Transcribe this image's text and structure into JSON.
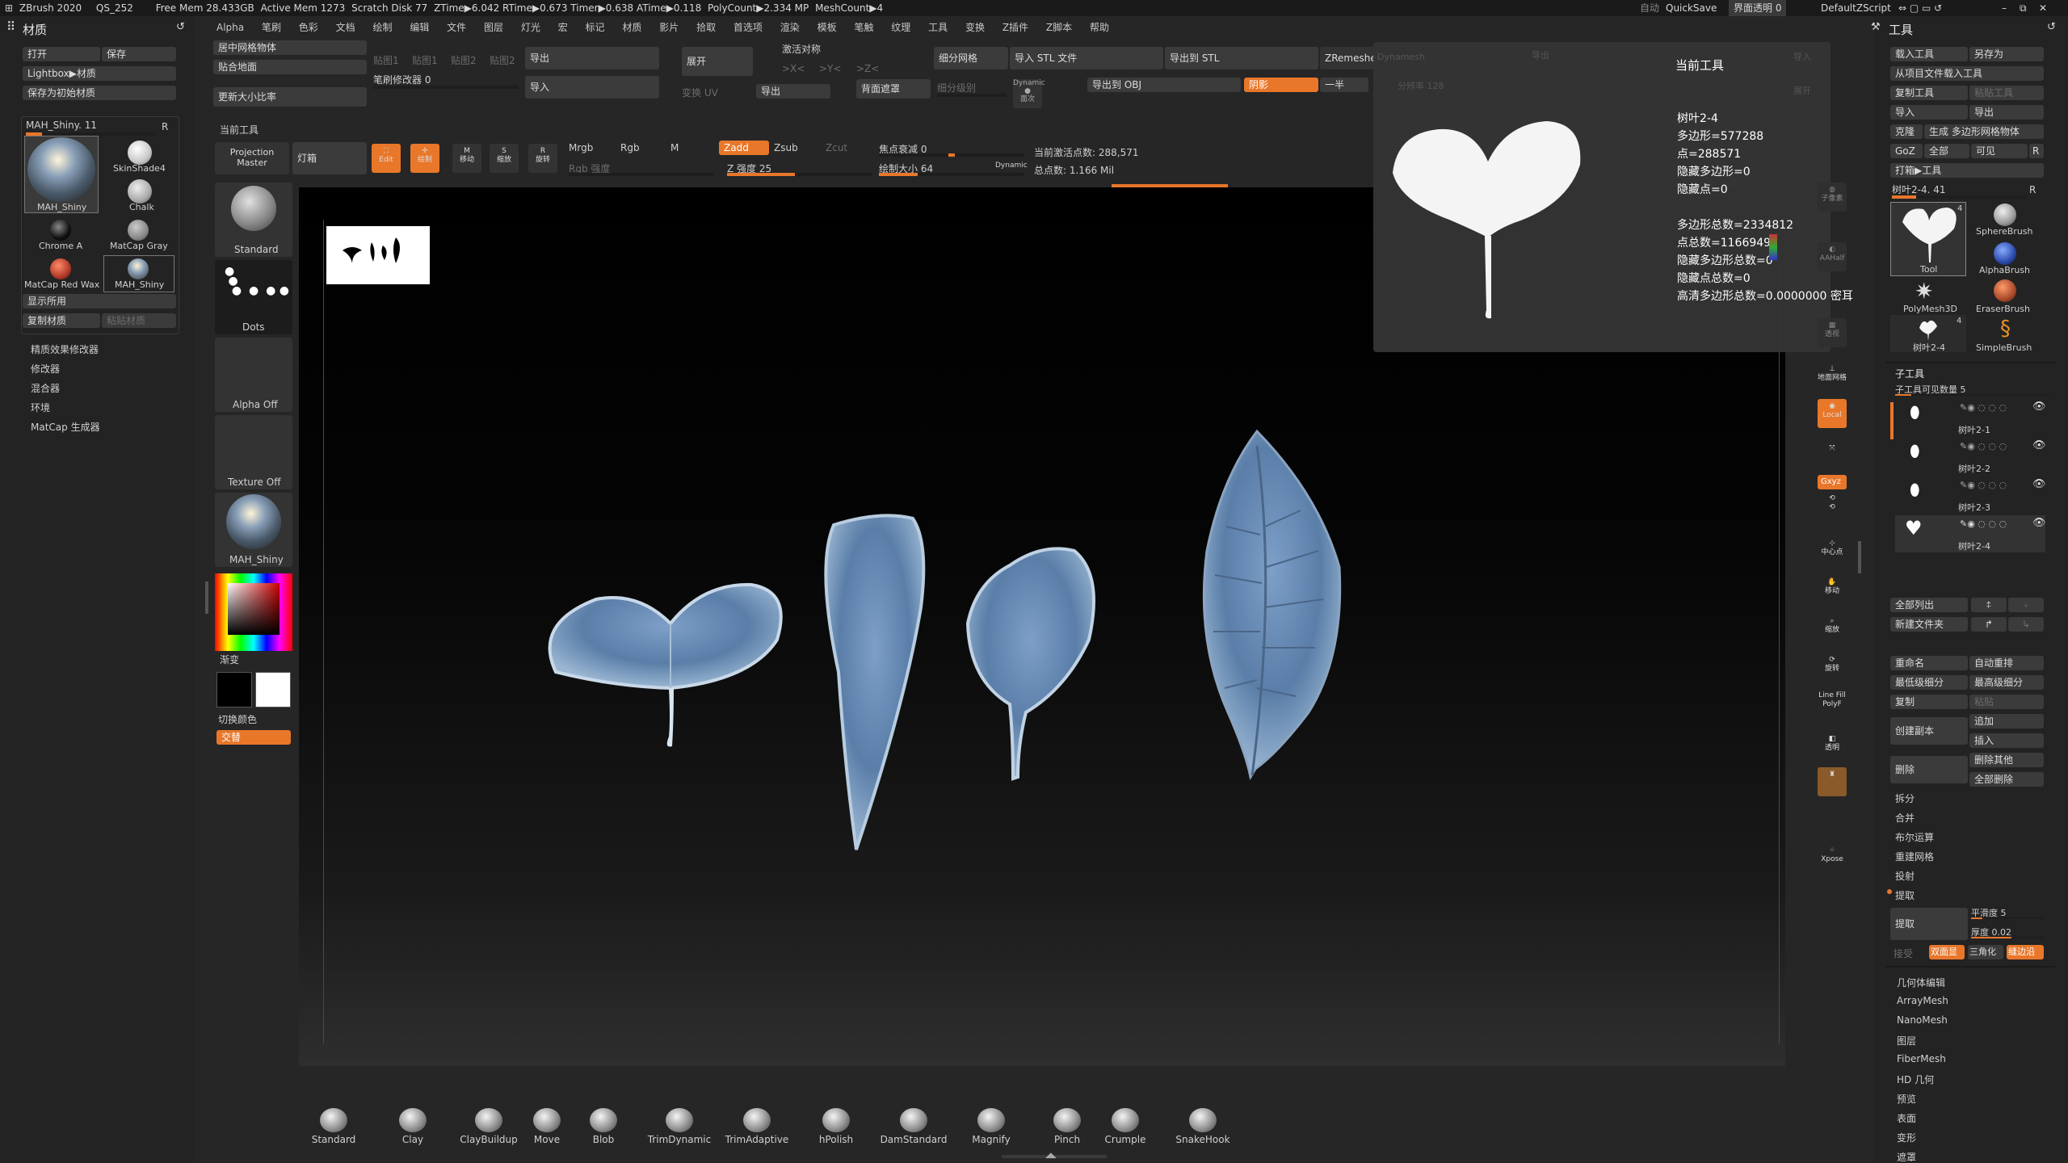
{
  "titlebar": {
    "app": "ZBrush 2020",
    "project": "QS_252",
    "free_mem": "Free Mem 28.433GB",
    "active_mem": "Active Mem 1273",
    "scratch": "Scratch Disk 77",
    "ztime": "ZTime▶6.042 RTime▶0.673 Timer▶0.638 ATime▶0.118",
    "polycount": "PolyCount▶2.334 MP",
    "meshcount": "MeshCount▶4",
    "auto": "自动",
    "quicksave": "QuickSave",
    "ui_transparency": "界面透明 0",
    "script": "DefaultZScript"
  },
  "menubar": [
    "Alpha",
    "笔刷",
    "色彩",
    "文档",
    "绘制",
    "编辑",
    "文件",
    "图层",
    "灯光",
    "宏",
    "标记",
    "材质",
    "影片",
    "拾取",
    "首选项",
    "渲染",
    "模板",
    "笔触",
    "纹理",
    "工具",
    "变换",
    "Z插件",
    "Z脚本",
    "帮助"
  ],
  "left_panel": {
    "title": "材质",
    "open": "打开",
    "save": "保存",
    "lightbox": "Lightbox▶材质",
    "save_default": "保存为初始材质",
    "current_material": "MAH_Shiny. 11",
    "r": "R",
    "materials": [
      {
        "name": "MAH_Shiny",
        "color": "#9aa6b0"
      },
      {
        "name": "SkinShade4",
        "color": "#f0f0f0"
      },
      {
        "name": "Chalk",
        "color": "#dadada"
      },
      {
        "name": "Chrome A",
        "color": "#1a1a1a"
      },
      {
        "name": "MatCap Gray",
        "color": "#9a9a9a"
      },
      {
        "name": "MatCap Red Wax",
        "color": "#b23a2a"
      },
      {
        "name": "MAH_Shiny",
        "color": "#9aa6b0"
      }
    ],
    "show_used": "显示所用",
    "copy_mat": "复制材质",
    "paste_mat": "粘贴材质",
    "sections": [
      "精质效果修改器",
      "修改器",
      "混合器",
      "环境",
      "MatCap 生成器"
    ]
  },
  "top_shelf": {
    "center_mesh": "居中网格物体",
    "snap_ground": "贴合地面",
    "update_ratio": "更新大小比率",
    "tex1": "贴图1",
    "tex2": "贴图1",
    "tex3": "贴图2",
    "tex4": "贴图2",
    "brush_modifier": "笔刷修改器 0",
    "brush_modifier_value": 0,
    "export": "导出",
    "import": "导入",
    "expand": "展开",
    "change_uv": "变换 UV",
    "export2": "导出",
    "activate_sym": "激活对称",
    "sym_x": ">X<",
    "sym_y": ">Y<",
    "sym_z": ">Z<",
    "backface": "背面遮罩",
    "subdiv": "细分网格",
    "subdiv_level": "细分级别",
    "dynamesh_small": "Dynamic",
    "dynamesh_label": "面次",
    "import_stl": "导入 STL 文件",
    "export_obj": "导出到 OBJ",
    "export_stl": "导出到 STL",
    "shadow": "阴影",
    "zremesher": "ZRemesher",
    "half": "一半",
    "dynamesh": "Dynamesh",
    "resolution": "分辨率 128",
    "export3": "导出",
    "import3": "导入",
    "expand2": "展开"
  },
  "toolbar2": {
    "current_tool": "当前工具",
    "projection_master": "Projection Master",
    "lightbox": "灯箱",
    "edit": "Edit",
    "draw": "绘制",
    "move": "移动",
    "scale": "缩放",
    "rotate": "旋转",
    "mrgb": "Mrgb",
    "rgb": "Rgb",
    "m": "M",
    "rgb_intensity": "Rgb 强度",
    "zadd": "Zadd",
    "zsub": "Zsub",
    "zcut": "Zcut",
    "z_intensity": "Z 强度 25",
    "z_intensity_value": 25,
    "focal_shift": "焦点衰减 0",
    "focal_shift_value": 0,
    "draw_size": "绘制大小 64",
    "draw_size_value": 64,
    "dynamic": "Dynamic",
    "active_points": "当前激活点数: 288,571",
    "total_points": "总点数: 1.166 Mil"
  },
  "left_shelf": {
    "brush": "Standard",
    "stroke": "Dots",
    "alpha": "Alpha Off",
    "texture": "Texture Off",
    "material": "MAH_Shiny",
    "gradient": "渐变",
    "switch_color": "切换颜色",
    "alternate": "交替"
  },
  "info_popup": {
    "title": "当前工具",
    "name": "树叶2-4",
    "polygons": "多边形=577288",
    "points": "点=288571",
    "hidden_polys": "隐藏多边形=0",
    "hidden_points": "隐藏点=0",
    "total_polys": "多边形总数=2334812",
    "total_points": "点总数=1166949",
    "hidden_total_polys": "隐藏多边形总数=0",
    "hidden_total_points": "隐藏点总数=0",
    "hd_polys": "高清多边形总数=0.0000000 密耳"
  },
  "right_shelf": [
    "子像素",
    "AAHalf",
    "透视",
    "地面网格",
    "Local",
    "Gxyz",
    "对称",
    "中心点",
    "移动",
    "缩放",
    "旋转",
    "Line Fill PolyF",
    "透明",
    "Xpose"
  ],
  "right_panel": {
    "title": "工具",
    "load_tool": "载入工具",
    "save_as": "另存为",
    "load_from_project": "从项目文件载入工具",
    "copy_tool": "复制工具",
    "paste_tool": "粘贴工具",
    "import": "导入",
    "export": "导出",
    "clone": "克隆",
    "make_polymesh": "生成 多边形网格物体",
    "goz": "GoZ",
    "all": "全部",
    "visible": "可见",
    "r": "R",
    "lightbox_tools": "打箱▶工具",
    "current_tool": "树叶2-4. 41",
    "tools": [
      "Tool",
      "SphereBrush",
      "AlphaBrush",
      "PolyMesh3D",
      "EraserBrush",
      "树叶2-4",
      "SimpleBrush"
    ],
    "tool_count": "4",
    "subtool_title": "子工具",
    "subtool_visible": "子工具可见数量 5",
    "subtools": [
      "树叶2-1",
      "树叶2-2",
      "树叶2-3",
      "树叶2-4"
    ],
    "list_all": "全部列出",
    "new_folder": "新建文件夹",
    "rename": "重命名",
    "auto_reorder": "自动重排",
    "lowest_subdiv": "最低级细分",
    "highest_subdiv": "最高级细分",
    "duplicate": "复制",
    "paste": "粘贴",
    "create_copy": "创建副本",
    "append": "追加",
    "insert": "插入",
    "delete": "删除",
    "delete_other": "删除其他",
    "delete_all": "全部删除",
    "split": "拆分",
    "merge": "合并",
    "boolean": "布尔运算",
    "remesh": "重建网格",
    "project": "投射",
    "extract_header": "提取",
    "extract_btn": "提取",
    "smooth": "平滑度 5",
    "thickness": "厚度 0.02",
    "accept": "接受",
    "double": "双面显",
    "tri": "三角化",
    "tcorne": "缝边沿",
    "sections": [
      "几何体编辑",
      "ArrayMesh",
      "NanoMesh",
      "图层",
      "FiberMesh",
      "HD 几何",
      "预览",
      "表面",
      "变形",
      "遮罩"
    ]
  },
  "brushes": [
    "Standard",
    "Clay",
    "ClayBuildup",
    "Move",
    "Blob",
    "TrimDynamic",
    "TrimAdaptive",
    "hPolish",
    "DamStandard",
    "Magnify",
    "Pinch",
    "Crumple",
    "SnakeHook"
  ],
  "colors": {
    "accent": "#e8772a",
    "leaf": "#5a7ea8",
    "panel": "#262626",
    "canvas": "#0a0a0a"
  }
}
